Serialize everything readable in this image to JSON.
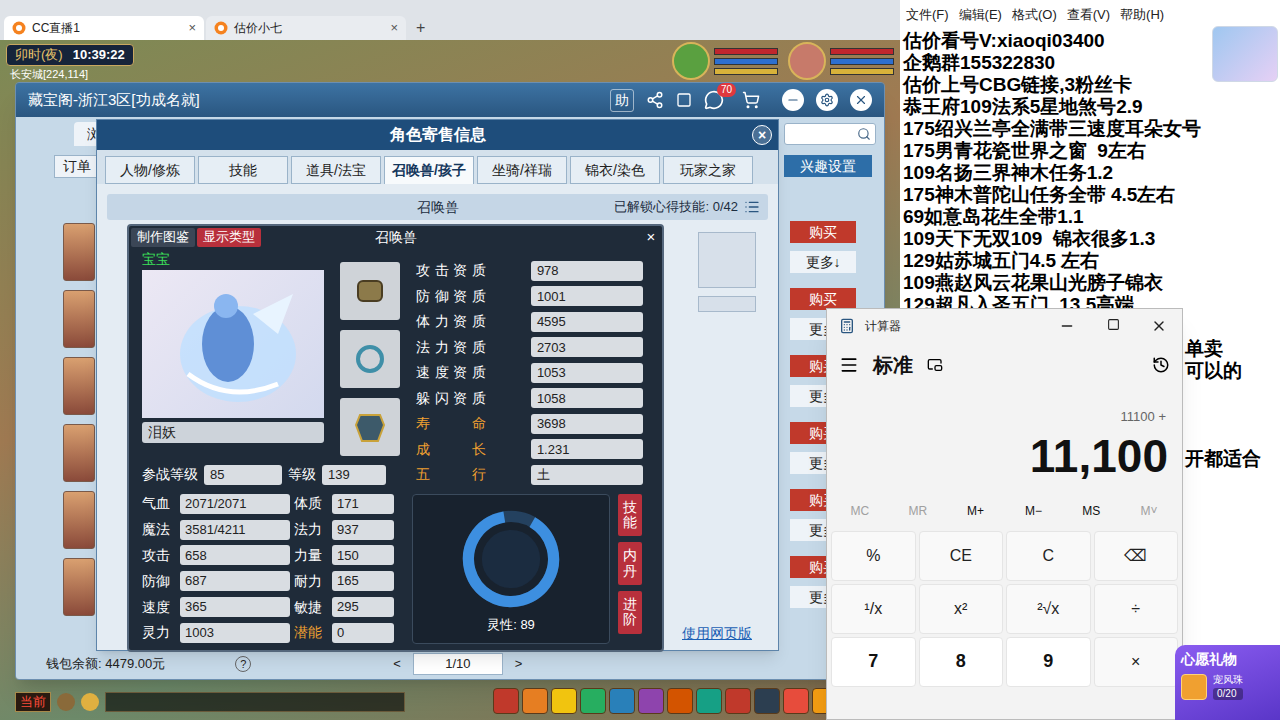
{
  "browser": {
    "tabs": [
      {
        "label": "CC直播1",
        "selected": true,
        "close": "×"
      },
      {
        "label": "估价小七",
        "selected": false,
        "close": "×"
      }
    ],
    "new_tab": "+"
  },
  "game": {
    "time_of_day": "卯时(夜)",
    "clock": "10:39:22",
    "location": "长安城[224,114]",
    "chat_channel": "当前"
  },
  "cbg": {
    "title": "藏宝阁-浙江3区[功成名就]",
    "help": "助",
    "messages_badge": "70",
    "browse_tab": "浏",
    "order_button": "订单",
    "interest_button": "兴趣设置",
    "listings": [
      {
        "buy": "购买",
        "more": "更多↓"
      },
      {
        "buy": "购买",
        "more": "更多"
      },
      {
        "buy": "购买",
        "more": "更多"
      },
      {
        "buy": "购买",
        "more": "更多"
      },
      {
        "buy": "购买",
        "more": "更多"
      },
      {
        "buy": "购买",
        "more": "更多"
      }
    ],
    "wallet": "钱包余额: 4479.00元",
    "wallet_help": "?",
    "pager": {
      "prev": "<",
      "page": "1/10",
      "next": ">"
    }
  },
  "panel": {
    "title": "角色寄售信息",
    "close": "×",
    "tabs": [
      {
        "label": "人物/修炼",
        "selected": false
      },
      {
        "label": "技能",
        "selected": false
      },
      {
        "label": "道具/法宝",
        "selected": false
      },
      {
        "label": "召唤兽/孩子",
        "selected": true
      },
      {
        "label": "坐骑/祥瑞",
        "selected": false
      },
      {
        "label": "锦衣/染色",
        "selected": false
      },
      {
        "label": "玩家之家",
        "selected": false
      }
    ],
    "section": "召唤兽",
    "unlocked_skills": "已解锁心得技能: 0/42",
    "web_link": "使用网页版"
  },
  "pet": {
    "header_buttons": [
      {
        "label": "制作图鉴",
        "color": "#3b4656"
      },
      {
        "label": "显示类型",
        "color": "#b8303c"
      }
    ],
    "title": "召唤兽",
    "close": "×",
    "type": "宝宝",
    "name": "泪妖",
    "levels": [
      {
        "label": "参战等级",
        "value": "85"
      },
      {
        "label": "等级",
        "value": "139"
      }
    ],
    "aptitudes": [
      {
        "label": "攻击资质",
        "value": "978",
        "color": "#ffffff"
      },
      {
        "label": "防御资质",
        "value": "1001",
        "color": "#ffffff"
      },
      {
        "label": "体力资质",
        "value": "4595",
        "color": "#ffffff"
      },
      {
        "label": "法力资质",
        "value": "2703",
        "color": "#ffffff"
      },
      {
        "label": "速度资质",
        "value": "1053",
        "color": "#ffffff"
      },
      {
        "label": "躲闪资质",
        "value": "1058",
        "color": "#ffffff"
      },
      {
        "label": "寿命",
        "value": "3698",
        "color": "#f0a030"
      },
      {
        "label": "成长",
        "value": "1.231",
        "color": "#f0a030"
      },
      {
        "label": "五行",
        "value": "土",
        "color": "#f0a030"
      }
    ],
    "attributes": [
      {
        "label": "气血",
        "value": "2071/2071",
        "color": "#ffffff"
      },
      {
        "label": "体质",
        "value": "171",
        "color": "#ffffff"
      },
      {
        "label": "魔法",
        "value": "3581/4211",
        "color": "#ffffff"
      },
      {
        "label": "法力",
        "value": "937",
        "color": "#ffffff"
      },
      {
        "label": "攻击",
        "value": "658",
        "color": "#ffffff"
      },
      {
        "label": "力量",
        "value": "150",
        "color": "#ffffff"
      },
      {
        "label": "防御",
        "value": "687",
        "color": "#ffffff"
      },
      {
        "label": "耐力",
        "value": "165",
        "color": "#ffffff"
      },
      {
        "label": "速度",
        "value": "365",
        "color": "#ffffff"
      },
      {
        "label": "敏捷",
        "value": "295",
        "color": "#ffffff"
      },
      {
        "label": "灵力",
        "value": "1003",
        "color": "#ffffff"
      },
      {
        "label": "潜能",
        "value": "0",
        "color": "#f0a030"
      }
    ],
    "spirit": {
      "label": "灵性: 89",
      "level": 0.89
    },
    "side_buttons": [
      "技能",
      "内丹",
      "进阶"
    ]
  },
  "notepad": {
    "menu": [
      "文件(F)",
      "编辑(E)",
      "格式(O)",
      "查看(V)",
      "帮助(H)"
    ],
    "lines": [
      "估价看号V:xiaoqi03400",
      "企鹅群155322830",
      "估价上号CBG链接,3粉丝卡",
      "恭王府109法系5星地煞号2.9",
      "175绍兴兰亭全满带三速度耳朵女号",
      "175男青花瓷世界之窗  9左右",
      "109名扬三界神木任务1.2",
      "175神木普陀山任务全带 4.5左右",
      "69如意岛花生全带1.1",
      "109天下无双109  锦衣很多1.3",
      "129姑苏城五门4.5 左右",
      "109燕赵风云花果山光膀子锦衣",
      "129超凡入圣五门  13.5高端"
    ],
    "lines_beside_calculator": [
      "",
      "单卖",
      "可以的",
      "",
      "",
      "",
      "开都适合"
    ]
  },
  "calculator": {
    "title": "计算器",
    "mode": "标准",
    "history": "11100 +",
    "display": "11,100",
    "memory": [
      {
        "label": "MC",
        "disabled": true
      },
      {
        "label": "MR",
        "disabled": true
      },
      {
        "label": "M+",
        "disabled": false
      },
      {
        "label": "M−",
        "disabled": false
      },
      {
        "label": "MS",
        "disabled": false
      },
      {
        "label": "M˅",
        "disabled": true
      }
    ],
    "keys": [
      {
        "label": "%",
        "kind": "function"
      },
      {
        "label": "CE",
        "kind": "function"
      },
      {
        "label": "C",
        "kind": "function"
      },
      {
        "label": "⌫",
        "kind": "function"
      },
      {
        "label": "¹/x",
        "kind": "function"
      },
      {
        "label": "x²",
        "kind": "function"
      },
      {
        "label": "²√x",
        "kind": "function"
      },
      {
        "label": "÷",
        "kind": "function"
      },
      {
        "label": "7",
        "kind": "number"
      },
      {
        "label": "8",
        "kind": "number"
      },
      {
        "label": "9",
        "kind": "number"
      },
      {
        "label": "×",
        "kind": "function"
      }
    ]
  },
  "gift": {
    "title": "心愿礼物",
    "item": "宠风珠",
    "progress": "0/20"
  }
}
